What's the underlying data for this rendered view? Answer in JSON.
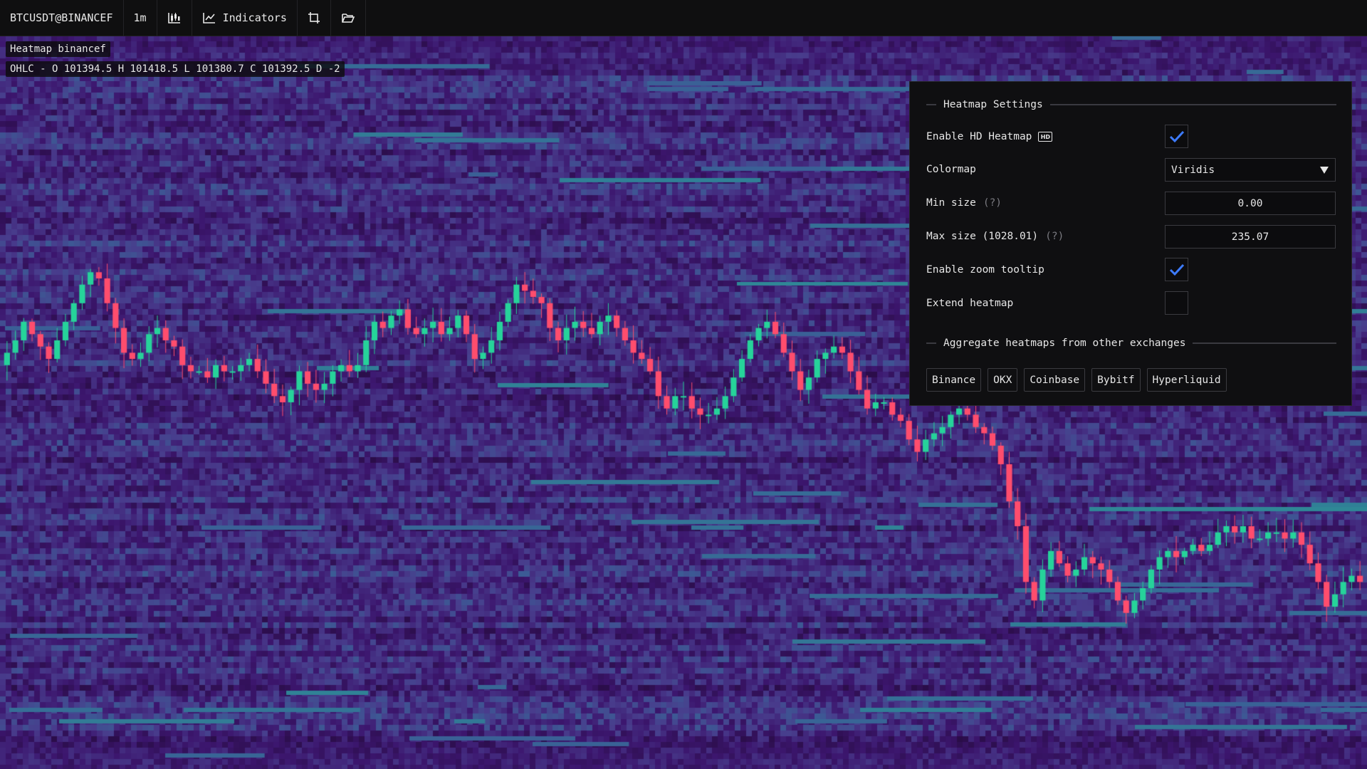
{
  "toolbar": {
    "symbol": "BTCUSDT@BINANCEF",
    "timeframe": "1m",
    "indicators_label": "Indicators"
  },
  "legend": {
    "title": "Heatmap binancef",
    "ohlc": "OHLC - O 101394.5 H 101418.5 L 101380.7 C 101392.5 D -2"
  },
  "settings": {
    "title": "Heatmap Settings",
    "hd_label": "Enable HD Heatmap",
    "hd_badge": "HD",
    "hd_enabled": true,
    "colormap_label": "Colormap",
    "colormap_value": "Viridis",
    "min_size_label": "Min size",
    "min_size_help": "(?)",
    "min_size_value": "0.00",
    "max_size_label": "Max size (1028.01)",
    "max_size_help": "(?)",
    "max_size_value": "235.07",
    "zoom_tooltip_label": "Enable zoom tooltip",
    "zoom_tooltip_enabled": true,
    "extend_label": "Extend heatmap",
    "extend_enabled": false,
    "aggregate_title": "Aggregate heatmaps from other exchanges",
    "exchanges": [
      "Binance",
      "OKX",
      "Coinbase",
      "Bybitf",
      "Hyperliquid"
    ]
  },
  "colors": {
    "up_candle": "#26d39a",
    "down_candle": "#ff4d6d",
    "checkbox_check": "#3d7bff",
    "heatmap_low": "#3b0f5c",
    "heatmap_high": "#2ab7a1"
  },
  "chart_data": {
    "type": "candlestick-heatmap",
    "series": [
      {
        "name": "close",
        "values": [
          0.58,
          0.6,
          0.63,
          0.61,
          0.59,
          0.57,
          0.6,
          0.63,
          0.66,
          0.69,
          0.71,
          0.7,
          0.66,
          0.62,
          0.58,
          0.57,
          0.58,
          0.61,
          0.62,
          0.6,
          0.59,
          0.56,
          0.55,
          0.55,
          0.54,
          0.56,
          0.55,
          0.55,
          0.56,
          0.57,
          0.55,
          0.53,
          0.51,
          0.5,
          0.52,
          0.55,
          0.53,
          0.52,
          0.53,
          0.55,
          0.56,
          0.55,
          0.56,
          0.6,
          0.63,
          0.62,
          0.64,
          0.65,
          0.62,
          0.61,
          0.62,
          0.63,
          0.61,
          0.62,
          0.64,
          0.61,
          0.57,
          0.58,
          0.6,
          0.63,
          0.66,
          0.69,
          0.68,
          0.67,
          0.66,
          0.62,
          0.6,
          0.62,
          0.63,
          0.62,
          0.61,
          0.63,
          0.64,
          0.62,
          0.6,
          0.58,
          0.57,
          0.55,
          0.51,
          0.49,
          0.51,
          0.51,
          0.49,
          0.48,
          0.48,
          0.49,
          0.51,
          0.54,
          0.57,
          0.6,
          0.62,
          0.63,
          0.61,
          0.58,
          0.55,
          0.52,
          0.54,
          0.57,
          0.58,
          0.59,
          0.58,
          0.55,
          0.52,
          0.49,
          0.5,
          0.5,
          0.48,
          0.47,
          0.44,
          0.42,
          0.44,
          0.45,
          0.46,
          0.48,
          0.49,
          0.48,
          0.46,
          0.45,
          0.43,
          0.4,
          0.34,
          0.3,
          0.21,
          0.18,
          0.23,
          0.26,
          0.24,
          0.22,
          0.23,
          0.25,
          0.24,
          0.23,
          0.21,
          0.18,
          0.16,
          0.18,
          0.2,
          0.23,
          0.25,
          0.26,
          0.25,
          0.26,
          0.27,
          0.26,
          0.27,
          0.29,
          0.3,
          0.29,
          0.3,
          0.28,
          0.28,
          0.29,
          0.29,
          0.28,
          0.29,
          0.27,
          0.24,
          0.21,
          0.17,
          0.19,
          0.21,
          0.22,
          0.21
        ]
      }
    ]
  }
}
